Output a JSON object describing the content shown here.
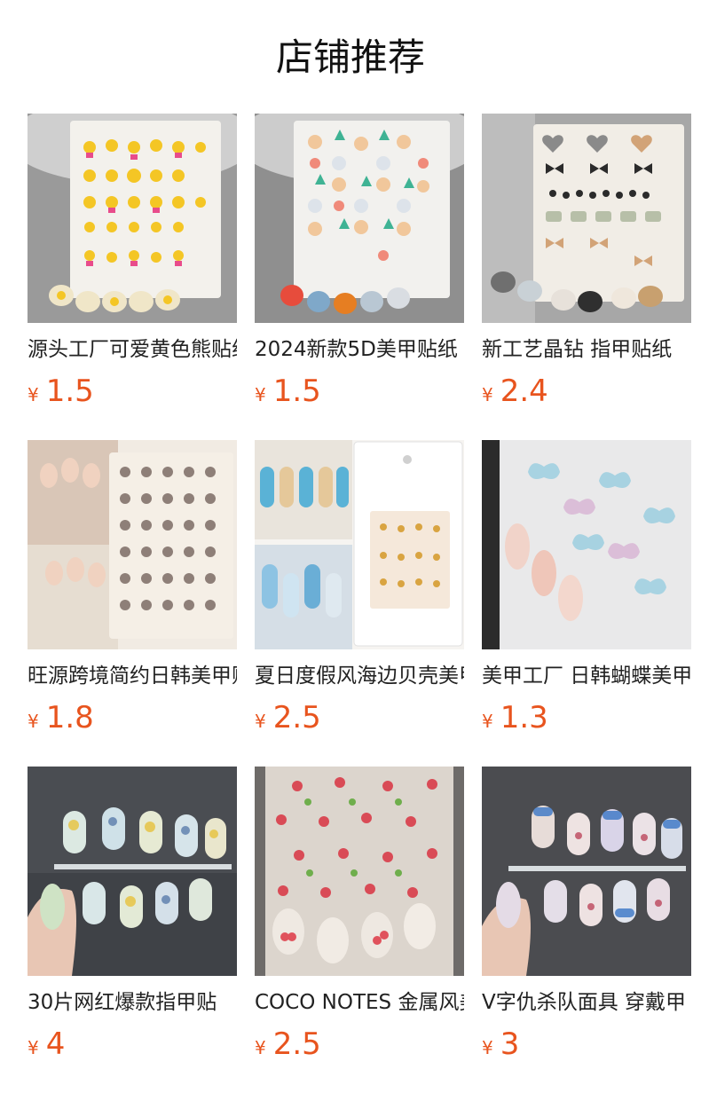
{
  "section": {
    "title": "店铺推荐"
  },
  "colors": {
    "price": "#e8541e",
    "title_text": "#111111"
  },
  "products": [
    {
      "name": "源头工厂可爱黄色熊贴纸",
      "currency": "¥",
      "price": "1.5",
      "image": "yellow-bear-nail-sticker-sheet"
    },
    {
      "name": "2024新款5D美甲贴纸",
      "currency": "¥",
      "price": "1.5",
      "image": "cartoon-bear-nail-sticker-sheet"
    },
    {
      "name": "新工艺晶钻 指甲贴纸",
      "currency": "¥",
      "price": "2.4",
      "image": "heart-bow-nail-sticker-sheet"
    },
    {
      "name": "旺源跨境简约日韩美甲贴",
      "currency": "¥",
      "price": "1.8",
      "image": "cat-face-nail-sticker-sheet"
    },
    {
      "name": "夏日度假风海边贝壳美甲",
      "currency": "¥",
      "price": "2.5",
      "image": "seaside-shell-nail-accessory-card"
    },
    {
      "name": "美甲工厂 日韩蝴蝶美甲贴",
      "currency": "¥",
      "price": "1.3",
      "image": "butterfly-nail-sticker-sheet"
    },
    {
      "name": "30片网红爆款指甲贴",
      "currency": "¥",
      "price": "4",
      "image": "watercolor-press-on-nails"
    },
    {
      "name": "COCO NOTES 金属风美甲",
      "currency": "¥",
      "price": "2.5",
      "image": "strawberry-cherry-nail-sticker-sheet"
    },
    {
      "name": "V字仇杀队面具 穿戴甲",
      "currency": "¥",
      "price": "3",
      "image": "mask-face-press-on-nails"
    }
  ]
}
